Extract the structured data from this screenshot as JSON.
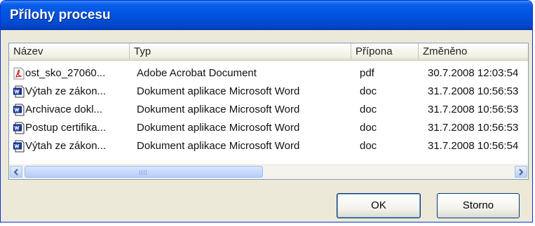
{
  "window": {
    "title": "Přílohy procesu"
  },
  "columns": {
    "name": "Název",
    "type": "Typ",
    "extension": "Přípona",
    "modified": "Změněno"
  },
  "files": [
    {
      "icon": "pdf-file-icon",
      "name": "ost_sko_27060...",
      "type": "Adobe Acrobat Document",
      "ext": "pdf",
      "modified": "30.7.2008 12:03:54"
    },
    {
      "icon": "word-file-icon",
      "name": "Výtah ze zákon...",
      "type": "Dokument aplikace Microsoft Word",
      "ext": "doc",
      "modified": "31.7.2008 10:56:53"
    },
    {
      "icon": "word-file-icon",
      "name": "Archivace dokl...",
      "type": "Dokument aplikace Microsoft Word",
      "ext": "doc",
      "modified": "31.7.2008 10:56:53"
    },
    {
      "icon": "word-file-icon",
      "name": "Postup certifika...",
      "type": "Dokument aplikace Microsoft Word",
      "ext": "doc",
      "modified": "31.7.2008 10:56:53"
    },
    {
      "icon": "word-file-icon",
      "name": "Výtah ze zákon...",
      "type": "Dokument aplikace Microsoft Word",
      "ext": "doc",
      "modified": "31.7.2008 10:56:54"
    }
  ],
  "buttons": {
    "ok": "OK",
    "cancel": "Storno"
  },
  "colors": {
    "title_bar": "#0054e3",
    "dialog_bg": "#ece9d8",
    "list_border": "#7f9db9"
  }
}
